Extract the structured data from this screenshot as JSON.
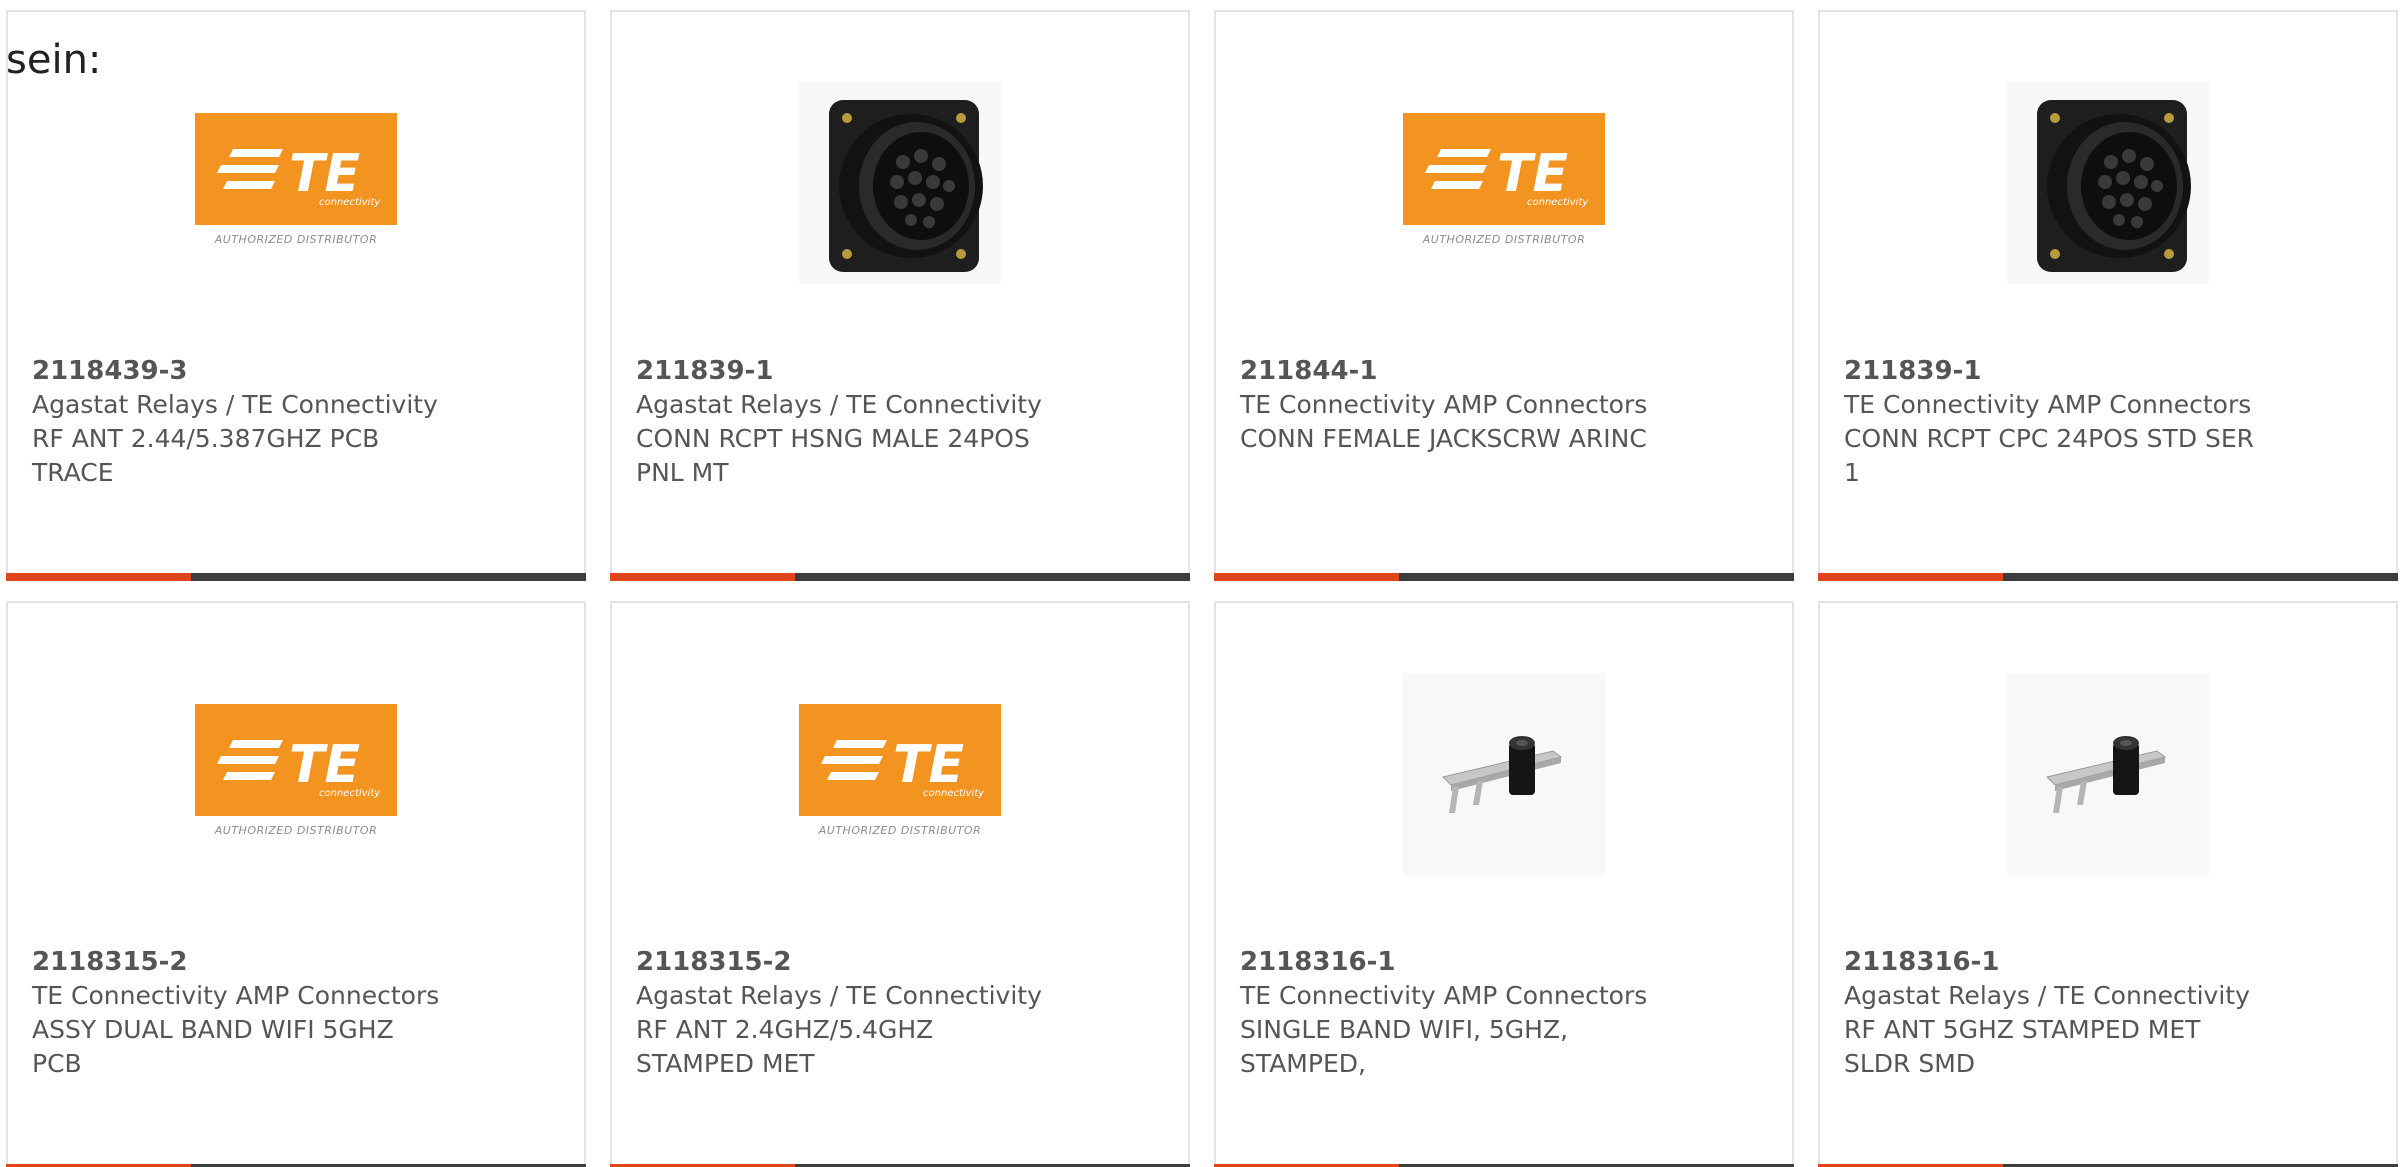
{
  "intro_text": "sein:",
  "te_logo": {
    "brand_text": "TE",
    "sub_brand": "connectivity",
    "tagline": "AUTHORIZED DISTRIBUTOR",
    "brand_color": "#f39421"
  },
  "accent_colors": {
    "bar_dark": "#3d3d3d",
    "bar_accent": "#e0451b"
  },
  "products": [
    {
      "image": "te-logo",
      "part_number": "2118439-3",
      "manufacturer": "Agastat Relays / TE Connectivity",
      "description": "RF ANT 2.44/5.387GHZ PCB\nTRACE"
    },
    {
      "image": "circular-connector",
      "part_number": "211839-1",
      "manufacturer": "Agastat Relays / TE Connectivity",
      "description": "CONN RCPT HSNG MALE 24POS\nPNL MT"
    },
    {
      "image": "te-logo",
      "part_number": "211844-1",
      "manufacturer": "TE Connectivity AMP Connectors",
      "description": "CONN FEMALE JACKSCRW ARINC"
    },
    {
      "image": "circular-connector",
      "part_number": "211839-1",
      "manufacturer": "TE Connectivity AMP Connectors",
      "description": "CONN RCPT CPC 24POS STD SER\n1"
    },
    {
      "image": "te-logo",
      "part_number": "2118315-2",
      "manufacturer": "TE Connectivity AMP Connectors",
      "description": "ASSY DUAL BAND WIFI 5GHZ\nPCB"
    },
    {
      "image": "te-logo",
      "part_number": "2118315-2",
      "manufacturer": "Agastat Relays / TE Connectivity",
      "description": "RF ANT 2.4GHZ/5.4GHZ\nSTAMPED MET"
    },
    {
      "image": "stamped-antenna",
      "part_number": "2118316-1",
      "manufacturer": "TE Connectivity AMP Connectors",
      "description": "SINGLE BAND WIFI, 5GHZ,\nSTAMPED,"
    },
    {
      "image": "stamped-antenna",
      "part_number": "2118316-1",
      "manufacturer": "Agastat Relays / TE Connectivity",
      "description": "RF ANT 5GHZ STAMPED MET\nSLDR SMD"
    }
  ]
}
